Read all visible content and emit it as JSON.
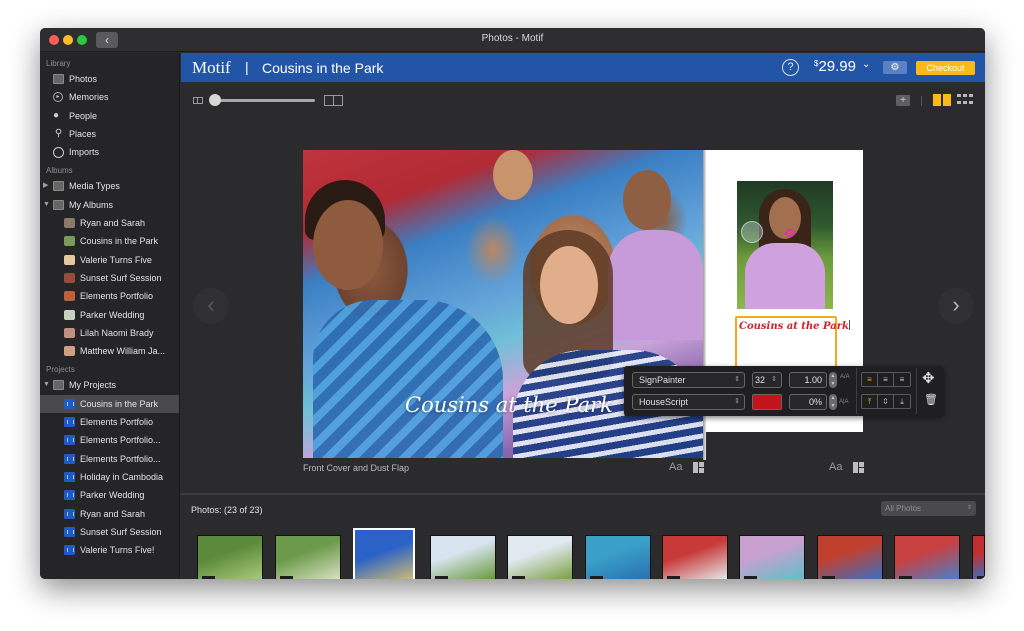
{
  "window": {
    "title": "Photos - Motif",
    "back_icon": "chevron-left"
  },
  "sidebar": {
    "library": {
      "heading": "Library",
      "items": [
        {
          "label": "Photos",
          "icon": "photos-icon"
        },
        {
          "label": "Memories",
          "icon": "memories-icon"
        },
        {
          "label": "People",
          "icon": "person-icon"
        },
        {
          "label": "Places",
          "icon": "pin-icon"
        },
        {
          "label": "Imports",
          "icon": "clock-icon"
        }
      ]
    },
    "albums": {
      "heading": "Albums",
      "folders": [
        {
          "label": "Media Types",
          "expanded": false
        },
        {
          "label": "My Albums",
          "expanded": true
        }
      ],
      "items": [
        {
          "label": "Ryan and Sarah",
          "color": "#8a7a6a"
        },
        {
          "label": "Cousins in the Park",
          "color": "#7a9a5a"
        },
        {
          "label": "Valerie Turns Five",
          "color": "#e6c7a0"
        },
        {
          "label": "Sunset Surf Session",
          "color": "#9a4a3a"
        },
        {
          "label": "Elements Portfolio",
          "color": "#c0603a"
        },
        {
          "label": "Parker Wedding",
          "color": "#c8d0c0"
        },
        {
          "label": "Lilah Naomi Brady",
          "color": "#c09080"
        },
        {
          "label": "Matthew William Ja...",
          "color": "#d0a080"
        }
      ]
    },
    "projects": {
      "heading": "Projects",
      "folder": {
        "label": "My Projects",
        "expanded": true
      },
      "selected_index": 0,
      "items": [
        {
          "label": "Cousins in the Park"
        },
        {
          "label": "Elements Portfolio"
        },
        {
          "label": "Elements Portfolio..."
        },
        {
          "label": "Elements Portfolio..."
        },
        {
          "label": "Holiday in Cambodia"
        },
        {
          "label": "Parker Wedding"
        },
        {
          "label": "Ryan and Sarah"
        },
        {
          "label": "Sunset Surf Session"
        },
        {
          "label": "Valerie Turns Five!"
        }
      ]
    }
  },
  "header": {
    "brand": "Motif",
    "separator": "|",
    "project_title": "Cousins in the Park",
    "help_label": "?",
    "price_currency": "$",
    "price_value": "29.99",
    "price_chevron": "⌄",
    "settings_icon": "⚙",
    "checkout_label": "Checkout",
    "brand_color": "#2355a6",
    "accent_color": "#fbb917"
  },
  "toolbar": {
    "zoom_level": 0.0,
    "add_page_label": "+",
    "view_mode": "spread"
  },
  "canvas": {
    "prev_icon": "‹",
    "next_icon": "›",
    "cover_title": "Cousins at the Park",
    "flap_text": "Cousins at the Park",
    "page_label": "Front Cover and Dust Flap",
    "aa_label": "Aa"
  },
  "text_tools": {
    "font_family": "SignPainter",
    "font_style": "HouseScript",
    "font_size": "32",
    "line_spacing": "1.00",
    "char_spacing": "0%",
    "color": "#c3141b",
    "line_spacing_icon": "A/A",
    "char_spacing_icon": "A|A",
    "align": [
      "≡",
      "≡",
      "≡"
    ],
    "align_selected": 0,
    "valign": [
      "⤒",
      "⇳",
      "⤓"
    ],
    "valign_selected": 0,
    "move_icon": "✥",
    "delete_icon": "🗑"
  },
  "tray": {
    "title": "Photos:  (23 of 23)",
    "filter": "All Photos",
    "check": "✓",
    "selected_index": 2,
    "thumbs": [
      {
        "desc": "kids running on grass",
        "colors": [
          "#5b8a3a",
          "#a9c97a"
        ]
      },
      {
        "desc": "kids in park sunlight",
        "colors": [
          "#6b9a4a",
          "#d8e0c0"
        ]
      },
      {
        "desc": "boy upside down playground",
        "colors": [
          "#2a62c8",
          "#f0d060"
        ]
      },
      {
        "desc": "girls with hula hoops",
        "colors": [
          "#d8e4f0",
          "#6a9a3a"
        ]
      },
      {
        "desc": "girls hula hoops 2",
        "colors": [
          "#e0e8f0",
          "#7aa040"
        ]
      },
      {
        "desc": "boy on playground",
        "colors": [
          "#3aa0c8",
          "#2a70b0"
        ]
      },
      {
        "desc": "girl on red slide",
        "colors": [
          "#c83a3a",
          "#e6e6e6"
        ]
      },
      {
        "desc": "three girls smiling",
        "colors": [
          "#c8a0d0",
          "#60c0c8"
        ]
      },
      {
        "desc": "boy smiling blue shirt",
        "colors": [
          "#c04030",
          "#3a70c0"
        ]
      },
      {
        "desc": "group of cousins",
        "colors": [
          "#c84040",
          "#4a80c8"
        ]
      },
      {
        "desc": "partial thumbnail",
        "colors": [
          "#c03030",
          "#3a70c0"
        ]
      }
    ]
  }
}
